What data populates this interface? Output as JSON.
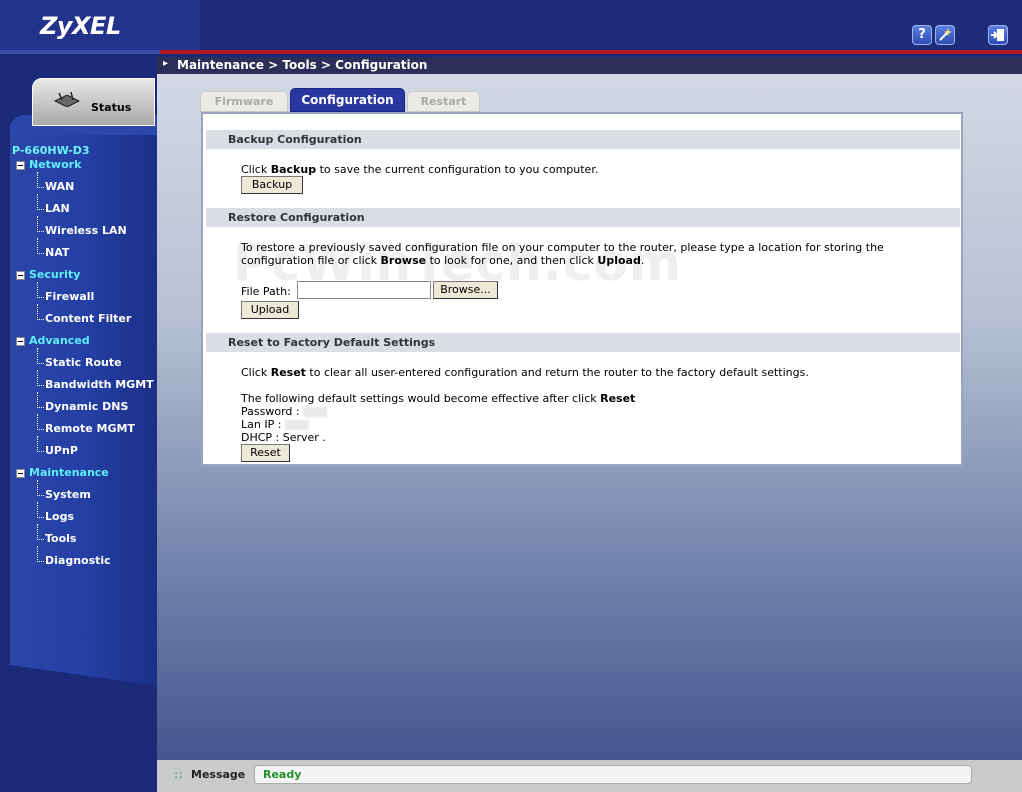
{
  "header": {
    "logo": "ZyXEL",
    "help_icon": "?",
    "wizard_icon": "wizard-icon",
    "logout_icon": "logout-icon"
  },
  "breadcrumb": "Maintenance > Tools > Configuration",
  "sidebar": {
    "status_label": "Status",
    "model": "P-660HW-D3",
    "categories": [
      {
        "label": "Network",
        "items": [
          "WAN",
          "LAN",
          "Wireless LAN",
          "NAT"
        ]
      },
      {
        "label": "Security",
        "items": [
          "Firewall",
          "Content Filter"
        ]
      },
      {
        "label": "Advanced",
        "items": [
          "Static Route",
          "Bandwidth MGMT",
          "Dynamic DNS",
          "Remote MGMT",
          "UPnP"
        ]
      },
      {
        "label": "Maintenance",
        "items": [
          "System",
          "Logs",
          "Tools",
          "Diagnostic"
        ]
      }
    ]
  },
  "tabs": [
    "Firmware",
    "Configuration",
    "Restart"
  ],
  "backup": {
    "title": "Backup Configuration",
    "text_pre": "Click ",
    "text_bold": "Backup",
    "text_post": " to save the current configuration to you computer.",
    "button": "Backup"
  },
  "restore": {
    "title": "Restore Configuration",
    "line1": "To restore a previously saved configuration file on your computer to the router, please type a location for storing the",
    "line2_pre": "configuration file or click ",
    "line2_bold1": "Browse",
    "line2_mid": " to look for one, and then click ",
    "line2_bold2": "Upload",
    "line2_post": ".",
    "file_label": "File Path:",
    "file_value": "",
    "browse_button": "Browse...",
    "upload_button": "Upload"
  },
  "reset": {
    "title": "Reset to Factory Default Settings",
    "text_pre": "Click ",
    "text_bold": "Reset",
    "text_post": " to clear all user-entered configuration and return the router to the factory default settings.",
    "defaults_pre": "The following default settings would become effective after click ",
    "defaults_bold": "Reset",
    "password_label": "Password :",
    "lanip_label": "Lan IP :",
    "dhcp_label": "DHCP : Server .",
    "button": "Reset"
  },
  "watermark": "PcWinTech.com",
  "message": {
    "label": "Message",
    "text": "Ready"
  },
  "colors": {
    "header_bg": "#1e2d7a",
    "accent_red": "#b01820",
    "active_tab": "#2a36a0",
    "nav_category": "#5ff0ff",
    "status_ready": "#1f8f2a"
  }
}
